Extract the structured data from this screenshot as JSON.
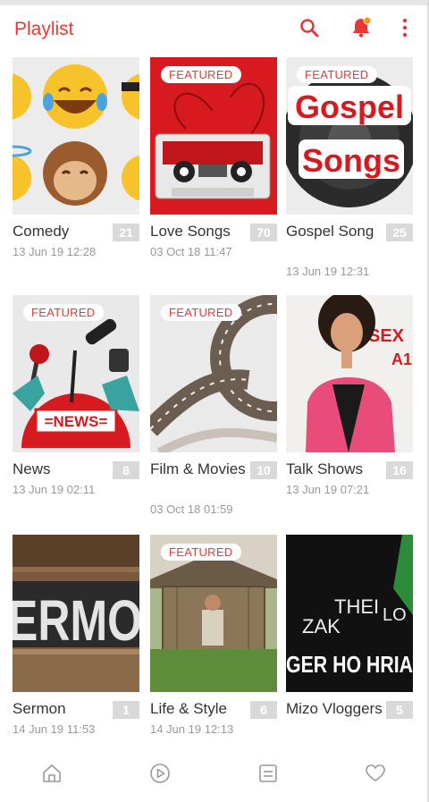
{
  "header": {
    "title": "Playlist"
  },
  "featured_label": "FEATURED",
  "colors": {
    "accent": "#e53935"
  },
  "playlists": [
    {
      "name": "Comedy",
      "count": "21",
      "date": "13 Jun 19 12:28",
      "featured": false
    },
    {
      "name": "Love Songs",
      "count": "70",
      "date": "03 Oct 18 11:47",
      "featured": true
    },
    {
      "name": "Gospel Song",
      "count": "25",
      "date": "13 Jun 19 12:31",
      "featured": true,
      "thumb_text": "Gospel Songs"
    },
    {
      "name": "News",
      "count": "8",
      "date": "13 Jun 19 02:11",
      "featured": true,
      "thumb_text": "=NEWS="
    },
    {
      "name": "Film & Movies",
      "count": "10",
      "date": "03 Oct 18 01:59",
      "featured": true
    },
    {
      "name": "Talk Shows",
      "count": "16",
      "date": "13 Jun 19 07:21",
      "featured": false,
      "thumb_text": "SEX A1"
    },
    {
      "name": "Sermon",
      "count": "1",
      "date": "14 Jun 19 11:53",
      "featured": false,
      "thumb_text": "ERMO"
    },
    {
      "name": "Life & Style",
      "count": "6",
      "date": "14 Jun 19 12:13",
      "featured": true
    },
    {
      "name": "Mizo Vloggers",
      "count": "5",
      "date": "",
      "featured": false,
      "thumb_text": "THEI LO ZAK GER HO HRIA"
    }
  ],
  "icons": {
    "search": "search-icon",
    "notifications": "bell-icon",
    "more": "more-vert-icon",
    "nav": [
      "home-icon",
      "play-circle-icon",
      "playlist-icon",
      "heart-icon"
    ]
  }
}
